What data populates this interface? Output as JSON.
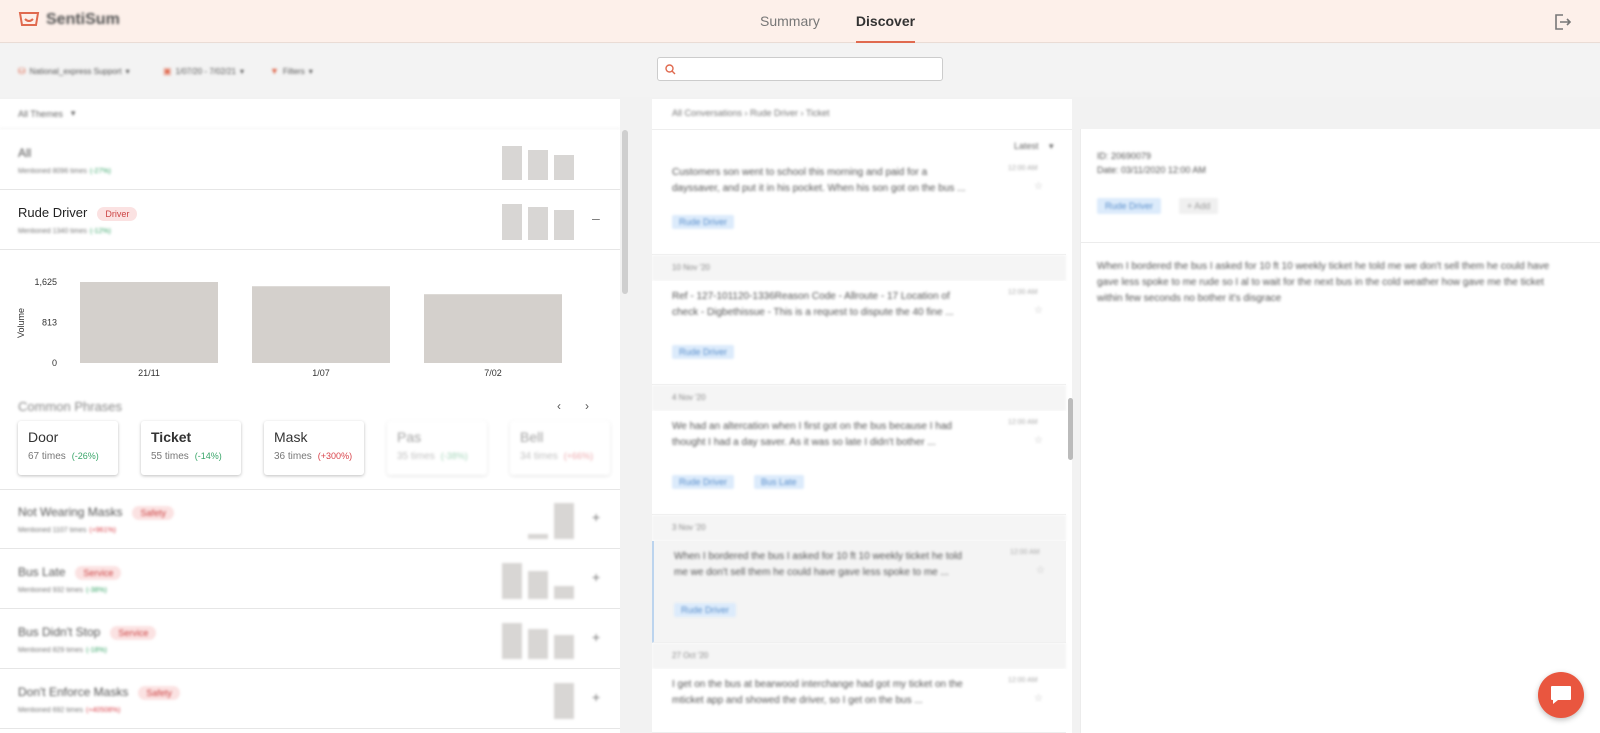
{
  "app": {
    "logo_text": "SentiSum"
  },
  "nav": {
    "tabs": [
      {
        "label": "Summary",
        "active": false
      },
      {
        "label": "Discover",
        "active": true
      }
    ]
  },
  "toolbar": {
    "workspace": "National_express Support",
    "date_range": "1/07/20 - 7/02/21",
    "filters": "Filters",
    "search_placeholder": ""
  },
  "left": {
    "all_themes_label": "All Themes",
    "themes": [
      {
        "name": "All",
        "badge": "",
        "sub_prefix": "Mentioned 8096 times",
        "change": "(-27%)",
        "change_dir": "pos",
        "spark": [
          0.9,
          0.8,
          0.65
        ],
        "toggle": ""
      },
      {
        "name": "Rude Driver",
        "badge": "Driver",
        "sub_prefix": "Mentioned 1340 times",
        "change": "(-12%)",
        "change_dir": "pos",
        "spark": [
          0.95,
          0.88,
          0.78
        ],
        "toggle": "–"
      },
      {
        "name": "Not Wearing Masks",
        "badge": "Safety",
        "sub_prefix": "Mentioned 1107 times",
        "change": "(+961%)",
        "change_dir": "neg",
        "spark": [
          0.0,
          0.12,
          0.95
        ],
        "toggle": "+"
      },
      {
        "name": "Bus Late",
        "badge": "Service",
        "sub_prefix": "Mentioned 932 times",
        "change": "(-38%)",
        "change_dir": "pos",
        "spark": [
          0.95,
          0.75,
          0.35
        ],
        "toggle": "+"
      },
      {
        "name": "Bus Didn't Stop",
        "badge": "Service",
        "sub_prefix": "Mentioned 829 times",
        "change": "(-18%)",
        "change_dir": "pos",
        "spark": [
          0.95,
          0.78,
          0.62
        ],
        "toggle": "+"
      },
      {
        "name": "Don't Enforce Masks",
        "badge": "Safety",
        "sub_prefix": "Mentioned 692 times",
        "change": "(+40508%)",
        "change_dir": "neg",
        "spark": [
          0.0,
          0.0,
          0.95
        ],
        "toggle": "+"
      }
    ],
    "common_phrases_label": "Common Phrases",
    "pager_prev": "‹",
    "pager_next": "›",
    "phrases": [
      {
        "name": "Door",
        "count": "67 times",
        "change": "(-26%)",
        "dir": "pos",
        "bold": false
      },
      {
        "name": "Ticket",
        "count": "55 times",
        "change": "(-14%)",
        "dir": "pos",
        "bold": true
      },
      {
        "name": "Mask",
        "count": "36 times",
        "change": "(+300%)",
        "dir": "neg",
        "bold": false
      },
      {
        "name": "Pas",
        "count": "35 times",
        "change": "(-38%)",
        "dir": "pos",
        "bold": false
      },
      {
        "name": "Bell",
        "count": "34 times",
        "change": "(+66%)",
        "dir": "neg",
        "bold": false
      }
    ]
  },
  "chart_data": {
    "type": "bar",
    "categories": [
      "21/11",
      "1/07",
      "7/02"
    ],
    "values": [
      1625,
      1540,
      1380
    ],
    "ylabel": "Volume",
    "ytick_labels": [
      "1,625",
      "813",
      "0"
    ],
    "ylim": [
      0,
      1625
    ],
    "color": "#d4d0cc"
  },
  "middle": {
    "breadcrumb": "All Conversations  ›  Rude Driver  ›  Ticket",
    "sort_label": "Latest",
    "conversations": [
      {
        "day": "",
        "text": "Customers son went to school this morning and paid for a dayssaver, and put it in his pocket. When his son got on the bus ...",
        "time": "12:00 AM",
        "tags": [
          "Rude Driver"
        ],
        "selected": false
      },
      {
        "day": "10 Nov '20",
        "text": "Ref - 127-101120-1336Reason Code - Allroute - 17 Location of check - Digbethissue - This is a request to dispute the 40 fine ...",
        "time": "12:00 AM",
        "tags": [
          "Rude Driver"
        ],
        "selected": false
      },
      {
        "day": "4 Nov '20",
        "text": "We had an altercation when I first got on the bus because I had thought I had a day saver. As it was so late I didn't bother ...",
        "time": "12:00 AM",
        "tags": [
          "Rude Driver",
          "Bus Late"
        ],
        "selected": false
      },
      {
        "day": "3 Nov '20",
        "text": "When I bordered the bus I asked for 10 ft 10 weekly ticket he told me we don't sell them he could have gave less spoke to me ...",
        "time": "12:00 AM",
        "tags": [
          "Rude Driver"
        ],
        "selected": true
      },
      {
        "day": "27 Oct '20",
        "text": "I get on the bus at bearwood interchange had got my ticket on the mticket app and showed the driver, so I get on the bus ...",
        "time": "12:00 AM",
        "tags": [],
        "selected": false
      }
    ]
  },
  "detail": {
    "id_line": "ID: 20690079",
    "date_line": "Date: 03/11/2020 12:00 AM",
    "tag": "Rude Driver",
    "add_label": "+ Add",
    "body": "When I bordered the bus I asked for 10 ft 10 weekly ticket he told me we don't sell them he could have gave less spoke to me rude so I al to wait for the next bus in the cold weather how gave me the ticket within few seconds no bother it's disgrace"
  },
  "colors": {
    "accent": "#e06a4f",
    "chat": "#e9563f",
    "tag_bg": "#dcebfb",
    "badge_bg": "#fbe2e2"
  },
  "icons": [
    "logo-icon",
    "logout-icon",
    "database-icon",
    "calendar-icon",
    "filter-icon",
    "search-icon",
    "chevron-down-icon",
    "star-icon",
    "chat-icon"
  ]
}
